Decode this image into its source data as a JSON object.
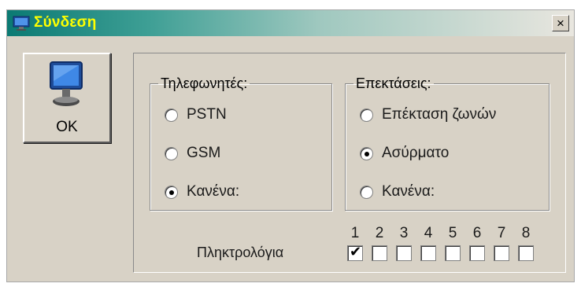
{
  "window": {
    "title": "Σύνδεση",
    "close_label": "×",
    "title_icon": "monitor-icon",
    "accent_color": "#0b7a73",
    "title_color": "#ffff00"
  },
  "ok_button": {
    "label": "OK",
    "icon": "monitor-icon"
  },
  "phones": {
    "legend": "Τηλεφωνητές:",
    "options": [
      {
        "label": "PSTN",
        "checked": false
      },
      {
        "label": "GSM",
        "checked": false
      },
      {
        "label": "Κανένα:",
        "checked": true
      }
    ]
  },
  "extensions": {
    "legend": "Επεκτάσεις:",
    "options": [
      {
        "label": "Επέκταση ζωνών",
        "checked": false
      },
      {
        "label": "Ασύρματο",
        "checked": true
      },
      {
        "label": "Κανένα:",
        "checked": false
      }
    ]
  },
  "keyboards": {
    "label": "Πληκτρολόγια",
    "numbers": [
      "1",
      "2",
      "3",
      "4",
      "5",
      "6",
      "7",
      "8"
    ],
    "checked": [
      true,
      false,
      false,
      false,
      false,
      false,
      false,
      false
    ]
  }
}
